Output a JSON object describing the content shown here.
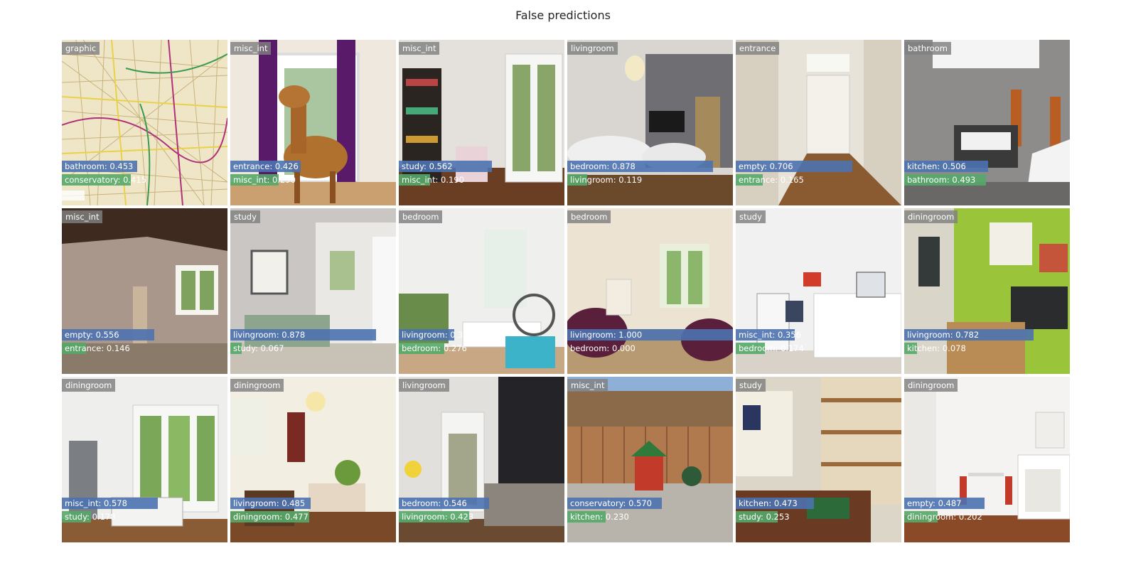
{
  "figure": {
    "title": "False predictions"
  },
  "colors": {
    "top_bar": "#4c72b0",
    "second_bar": "#55a868",
    "label_bg": "#808080"
  },
  "tiles": [
    {
      "true_label": "graphic",
      "p1_label": "bathroom: 0.453",
      "p1": 0.453,
      "p2_label": "conservatory: 0.415",
      "p2": 0.415,
      "scene": "map"
    },
    {
      "true_label": "misc_int",
      "p1_label": "entrance: 0.426",
      "p1": 0.426,
      "p2_label": "misc_int: 0.290",
      "p2": 0.29,
      "scene": "horse"
    },
    {
      "true_label": "misc_int",
      "p1_label": "study: 0.562",
      "p1": 0.562,
      "p2_label": "misc_int: 0.190",
      "p2": 0.19,
      "scene": "playroom"
    },
    {
      "true_label": "livingroom",
      "p1_label": "bedroom: 0.878",
      "p1": 0.878,
      "p2_label": "livingroom: 0.119",
      "p2": 0.119,
      "scene": "lounge"
    },
    {
      "true_label": "entrance",
      "p1_label": "empty: 0.706",
      "p1": 0.706,
      "p2_label": "entrance: 0.165",
      "p2": 0.165,
      "scene": "hallway"
    },
    {
      "true_label": "bathroom",
      "p1_label": "kitchen: 0.506",
      "p1": 0.506,
      "p2_label": "bathroom: 0.493",
      "p2": 0.493,
      "scene": "bathroom"
    },
    {
      "true_label": "misc_int",
      "p1_label": "empty: 0.556",
      "p1": 0.556,
      "p2_label": "entrance: 0.146",
      "p2": 0.146,
      "scene": "derelict"
    },
    {
      "true_label": "study",
      "p1_label": "livingroom: 0.878",
      "p1": 0.878,
      "p2_label": "study: 0.067",
      "p2": 0.067,
      "scene": "study-sofa"
    },
    {
      "true_label": "bedroom",
      "p1_label": "livingroom: 0.333",
      "p1": 0.333,
      "p2_label": "bedroom: 0.276",
      "p2": 0.276,
      "scene": "kids-bedroom"
    },
    {
      "true_label": "bedroom",
      "p1_label": "livingroom: 1.000",
      "p1": 1.0,
      "p2_label": "bedroom: 0.000",
      "p2": 0.0,
      "scene": "sofas"
    },
    {
      "true_label": "study",
      "p1_label": "misc_int: 0.356",
      "p1": 0.356,
      "p2_label": "bedroom: 0.174",
      "p2": 0.174,
      "scene": "white-room"
    },
    {
      "true_label": "diningroom",
      "p1_label": "livingroom: 0.782",
      "p1": 0.782,
      "p2_label": "kitchen: 0.078",
      "p2": 0.078,
      "scene": "green-kitchen"
    },
    {
      "true_label": "diningroom",
      "p1_label": "misc_int: 0.578",
      "p1": 0.578,
      "p2_label": "study: 0.178",
      "p2": 0.178,
      "scene": "bay-window"
    },
    {
      "true_label": "diningroom",
      "p1_label": "livingroom: 0.485",
      "p1": 0.485,
      "p2_label": "diningroom: 0.477",
      "p2": 0.477,
      "scene": "dining"
    },
    {
      "true_label": "livingroom",
      "p1_label": "bedroom: 0.546",
      "p1": 0.546,
      "p2_label": "livingroom: 0.423",
      "p2": 0.423,
      "scene": "dark-wall"
    },
    {
      "true_label": "misc_int",
      "p1_label": "conservatory: 0.570",
      "p1": 0.57,
      "p2_label": "kitchen: 0.230",
      "p2": 0.23,
      "scene": "garden"
    },
    {
      "true_label": "study",
      "p1_label": "kitchen: 0.473",
      "p1": 0.473,
      "p2_label": "study: 0.253",
      "p2": 0.253,
      "scene": "shelves"
    },
    {
      "true_label": "diningroom",
      "p1_label": "empty: 0.487",
      "p1": 0.487,
      "p2_label": "diningroom: 0.202",
      "p2": 0.202,
      "scene": "fireplace"
    }
  ]
}
